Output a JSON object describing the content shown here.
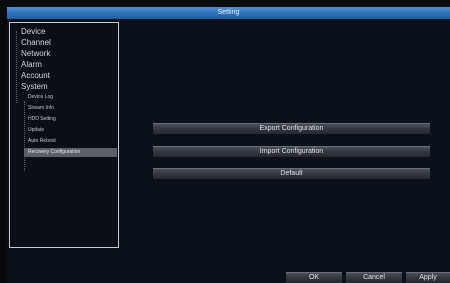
{
  "window": {
    "title": "Setting"
  },
  "sidebar": {
    "items": [
      {
        "label": "Device"
      },
      {
        "label": "Channel"
      },
      {
        "label": "Network"
      },
      {
        "label": "Alarm"
      },
      {
        "label": "Account"
      },
      {
        "label": "System"
      }
    ],
    "system_children": [
      {
        "label": "Device Log"
      },
      {
        "label": "Stream Info"
      },
      {
        "label": "HDD Setting"
      },
      {
        "label": "Update"
      },
      {
        "label": "Auto Reboot"
      },
      {
        "label": "Recovery Configuration",
        "selected": true
      }
    ]
  },
  "main": {
    "export_label": "Export Configuration",
    "import_label": "Import Configuration",
    "default_label": "Default"
  },
  "footer": {
    "ok_label": "OK",
    "cancel_label": "Cancel",
    "apply_label": "Apply"
  },
  "colors": {
    "title_bar": "#2d6fb8",
    "background": "#0c1018",
    "selected_item": "#5a5f68"
  }
}
